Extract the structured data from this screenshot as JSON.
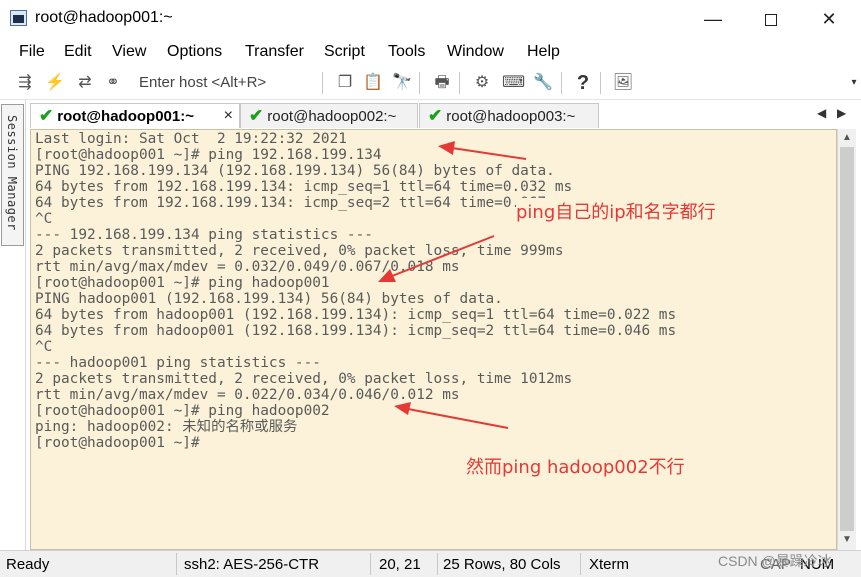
{
  "window": {
    "title": "root@hadoop001:~",
    "minimize": "—",
    "close": "✕"
  },
  "menu": [
    "File",
    "Edit",
    "View",
    "Options",
    "Transfer",
    "Script",
    "Tools",
    "Window",
    "Help"
  ],
  "toolbar": {
    "enter_host": "Enter host <Alt+R>"
  },
  "session_manager": {
    "label": "Session Manager"
  },
  "tabs": [
    {
      "label": "root@hadoop001:~",
      "active": true,
      "close": "×"
    },
    {
      "label": "root@hadoop002:~",
      "active": false
    },
    {
      "label": "root@hadoop003:~",
      "active": false
    }
  ],
  "terminal": {
    "background": "#fbf2d9",
    "lines": [
      "Last login: Sat Oct  2 19:22:32 2021",
      "[root@hadoop001 ~]# ping 192.168.199.134",
      "PING 192.168.199.134 (192.168.199.134) 56(84) bytes of data.",
      "64 bytes from 192.168.199.134: icmp_seq=1 ttl=64 time=0.032 ms",
      "64 bytes from 192.168.199.134: icmp_seq=2 ttl=64 time=0.067 ms",
      "^C",
      "--- 192.168.199.134 ping statistics ---",
      "2 packets transmitted, 2 received, 0% packet loss, time 999ms",
      "rtt min/avg/max/mdev = 0.032/0.049/0.067/0.018 ms",
      "[root@hadoop001 ~]# ping hadoop001",
      "PING hadoop001 (192.168.199.134) 56(84) bytes of data.",
      "64 bytes from hadoop001 (192.168.199.134): icmp_seq=1 ttl=64 time=0.022 ms",
      "64 bytes from hadoop001 (192.168.199.134): icmp_seq=2 ttl=64 time=0.046 ms",
      "^C",
      "--- hadoop001 ping statistics ---",
      "2 packets transmitted, 2 received, 0% packet loss, time 1012ms",
      "rtt min/avg/max/mdev = 0.022/0.034/0.046/0.012 ms",
      "[root@hadoop001 ~]# ping hadoop002",
      "ping: hadoop002: 未知的名称或服务",
      "[root@hadoop001 ~]#"
    ]
  },
  "annotations": {
    "color": "#e53935",
    "note1": "ping自己的ip和名字都行",
    "note2": "然而ping hadoop002不行"
  },
  "statusbar": {
    "ready": "Ready",
    "cipher": "ssh2: AES-256-CTR",
    "cursor": "20,  21",
    "size": "25 Rows, 80 Cols",
    "term": "Xterm",
    "caps": "CAP",
    "num": "NUM"
  },
  "watermark": "CSDN @暴躁冷冰"
}
